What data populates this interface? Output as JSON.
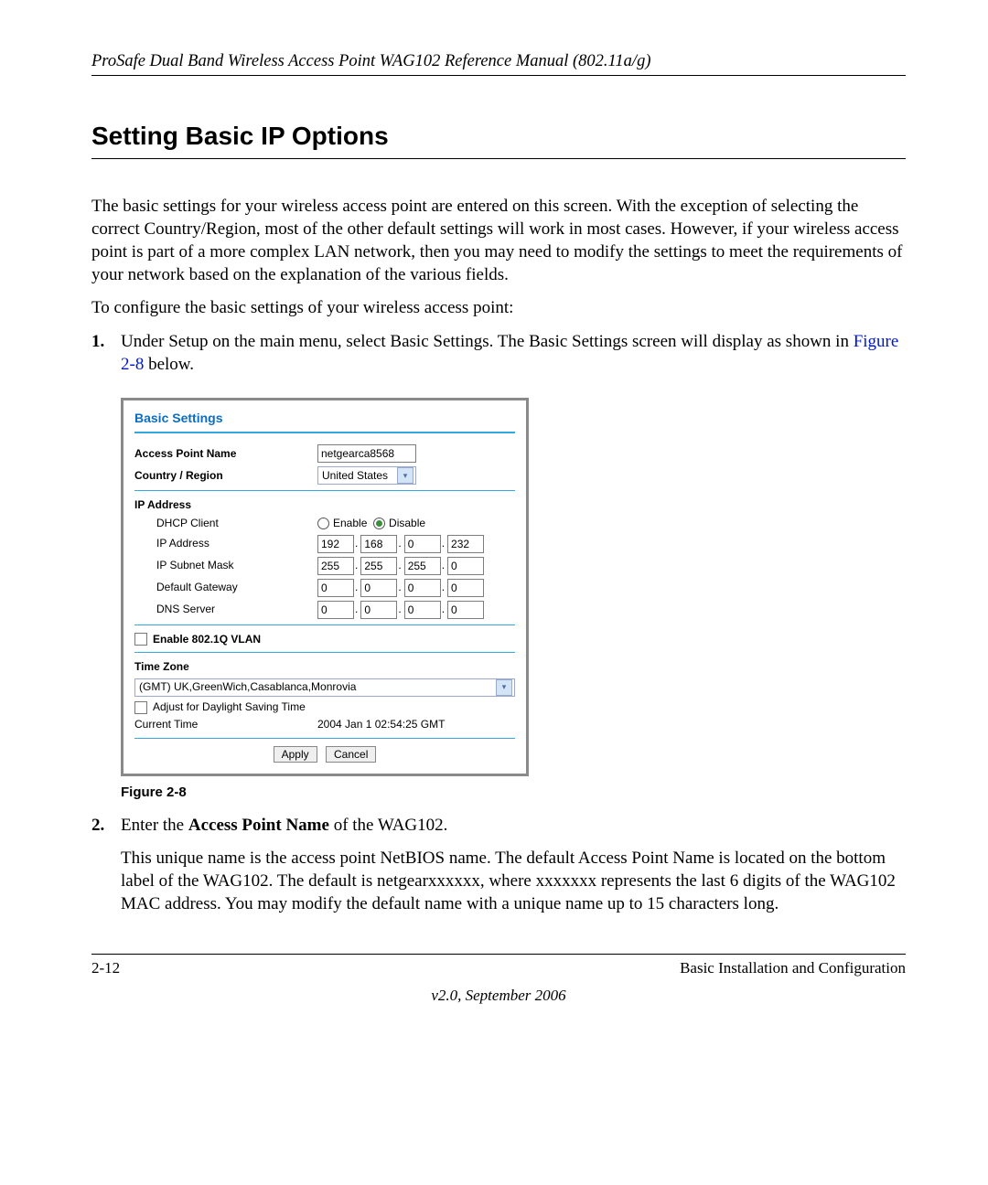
{
  "header": "ProSafe Dual Band Wireless Access Point WAG102 Reference Manual (802.11a/g)",
  "title": "Setting Basic IP Options",
  "para1": "The basic settings for your wireless access point are entered on this screen. With the exception of selecting the correct Country/Region, most of the other default settings will work in most cases. However, if your wireless access point is part of a more complex LAN network, then you may need to modify the settings to meet the requirements of your network based on the explanation of the various fields.",
  "para2": "To configure the basic settings of your wireless access point:",
  "step1a": "Under Setup on the main menu, select Basic Settings. The Basic Settings screen will display as shown in ",
  "step1_fig": "Figure 2-8",
  "step1b": " below.",
  "fig_caption": "Figure 2-8",
  "step2a": "Enter the ",
  "step2_kw": "Access Point Name",
  "step2b": " of the WAG102.",
  "step2_para": "This unique name is the access point NetBIOS name. The default Access Point Name is located on the bottom label of the WAG102. The default is netgearxxxxxx, where xxxxxxx represents the last 6 digits of the WAG102 MAC address. You may modify the default name with a unique name up to 15 characters long.",
  "panel": {
    "title": "Basic Settings",
    "apn_label": "Access Point Name",
    "apn_value": "netgearca8568",
    "country_label": "Country / Region",
    "country_value": "United States",
    "ip_head": "IP Address",
    "dhcp_label": "DHCP Client",
    "enable": "Enable",
    "disable": "Disable",
    "ip_label": "IP Address",
    "ip": [
      "192",
      "168",
      "0",
      "232"
    ],
    "mask_label": "IP Subnet Mask",
    "mask": [
      "255",
      "255",
      "255",
      "0"
    ],
    "gw_label": "Default Gateway",
    "gw": [
      "0",
      "0",
      "0",
      "0"
    ],
    "dns_label": "DNS Server",
    "dns": [
      "0",
      "0",
      "0",
      "0"
    ],
    "vlan_label": "Enable 802.1Q VLAN",
    "tz_head": "Time Zone",
    "tz_value": "(GMT) UK,GreenWich,Casablanca,Monrovia",
    "dst_label": "Adjust for Daylight Saving Time",
    "ct_label": "Current Time",
    "ct_value": "2004 Jan 1 02:54:25 GMT",
    "apply": "Apply",
    "cancel": "Cancel"
  },
  "footer": {
    "page": "2-12",
    "section": "Basic Installation and Configuration",
    "version": "v2.0, September 2006"
  }
}
